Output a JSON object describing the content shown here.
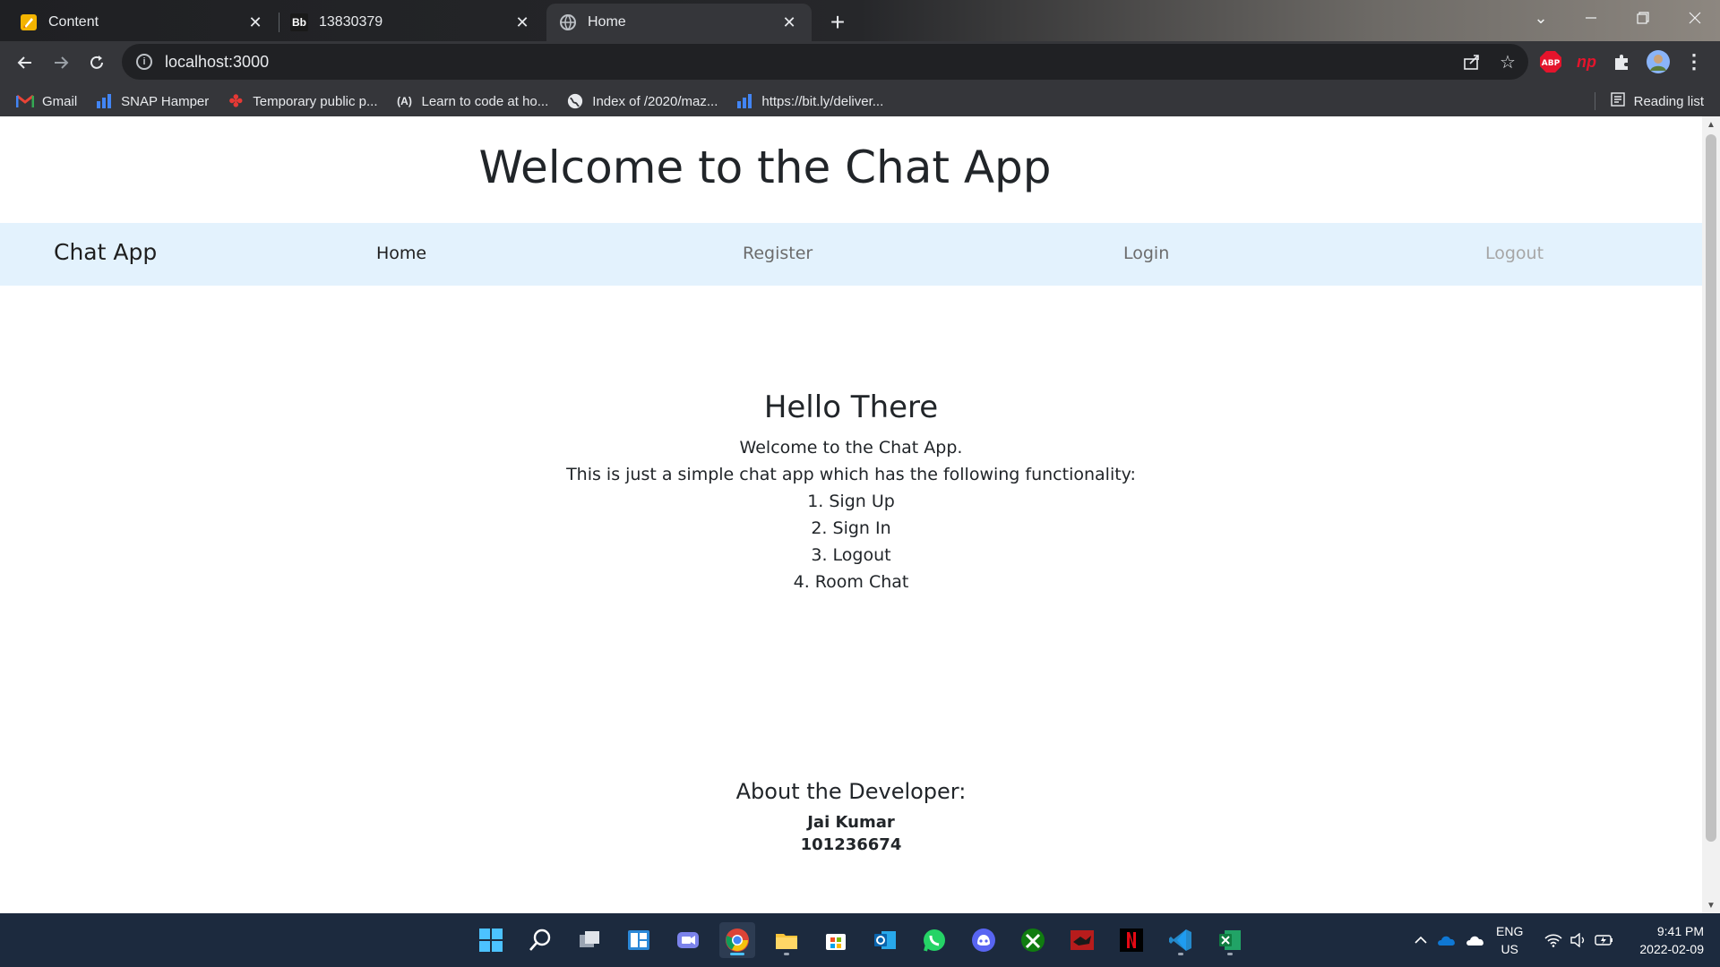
{
  "browser": {
    "tabs": [
      {
        "title": "Content",
        "favicon": "pencil-icon",
        "active": false
      },
      {
        "title": "13830379",
        "favicon": "blackboard-icon",
        "active": false
      },
      {
        "title": "Home",
        "favicon": "globe-icon",
        "active": true
      }
    ],
    "address": "localhost:3000",
    "bookmarks": [
      {
        "label": "Gmail",
        "icon": "gmail-icon"
      },
      {
        "label": "SNAP Hamper",
        "icon": "bar-chart-icon"
      },
      {
        "label": "Temporary public p...",
        "icon": "maple-leaf-icon"
      },
      {
        "label": "Learn to code at ho...",
        "icon": "code-icon"
      },
      {
        "label": "Index of /2020/maz...",
        "icon": "globe-icon"
      },
      {
        "label": "https://bit.ly/deliver...",
        "icon": "bar-chart-icon"
      }
    ],
    "reading_list": "Reading list",
    "extensions": {
      "abp": "ABP",
      "np": "np"
    }
  },
  "page": {
    "title": "Welcome to the Chat App",
    "nav": {
      "brand": "Chat App",
      "links": [
        "Home",
        "Register",
        "Login",
        "Logout"
      ]
    },
    "hello": "Hello There",
    "lines": [
      "Welcome to the Chat App.",
      "This is just a simple chat app which has the following functionality:",
      "1. Sign Up",
      "2. Sign In",
      "3. Logout",
      "4. Room Chat"
    ],
    "about": {
      "heading": "About the Developer:",
      "name": "Jai Kumar",
      "id": "101236674"
    }
  },
  "taskbar": {
    "lang": "ENG",
    "region": "US",
    "time": "9:41 PM",
    "date": "2022-02-09"
  },
  "colors": {
    "navbar_bg": "#e3f2fd",
    "taskbar_bg": "#1c2a3e",
    "chrome_bg": "#35363a"
  }
}
